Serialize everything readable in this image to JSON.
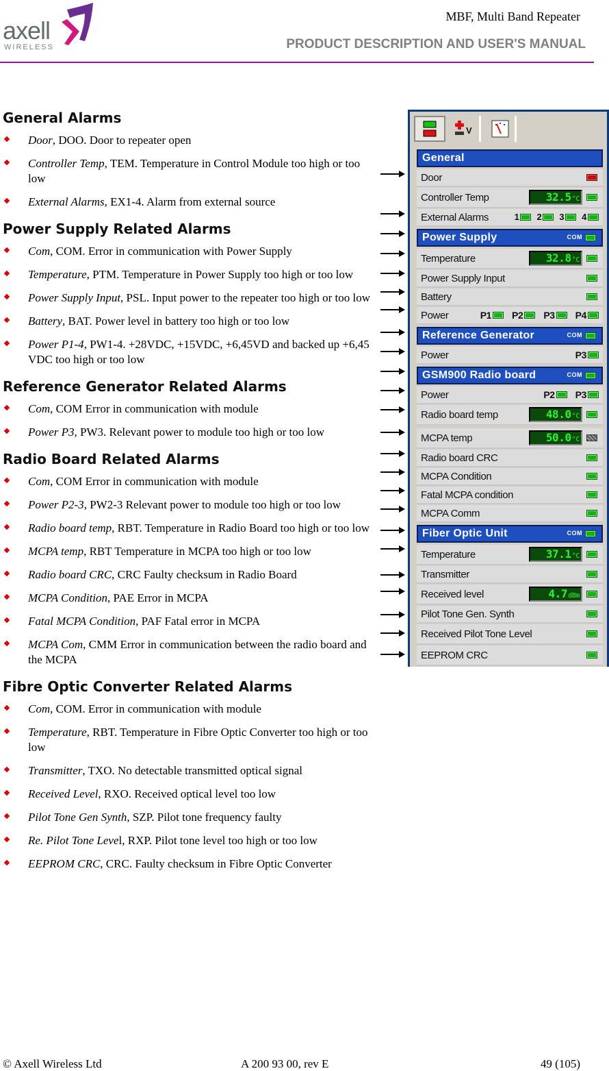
{
  "header": {
    "logo_word": "axell",
    "logo_sub": "WIRELESS",
    "title": "MBF, Multi Band Repeater",
    "subtitle": "PRODUCT DESCRIPTION AND USER'S MANUAL"
  },
  "sections": [
    {
      "heading": "General Alarms",
      "items": [
        {
          "term": "Door",
          "text": ", DOO. Door to repeater open"
        },
        {
          "term": "Controller Temp",
          "text": ", TEM. Temperature in Control Module too high or too low"
        },
        {
          "term": "External Alarms",
          "text": ", EX1-4. Alarm from external source"
        }
      ]
    },
    {
      "heading": "Power Supply Related Alarms",
      "items": [
        {
          "term": "Com",
          "text": ", COM. Error in communication with Power Supply"
        },
        {
          "term": "Temperature",
          "text": ", PTM. Temperature in Power Supply too high or too low"
        },
        {
          "term": "Power Supply Input",
          "text": ", PSL. Input power to the repeater too high or too low"
        },
        {
          "term": "Battery",
          "text": ", BAT. Power level in battery too high or too low"
        },
        {
          "term": "Power P1-4",
          "text": ", PW1-4. +28VDC, +15VDC, +6,45VD and backed up +6,45 VDC too high or too low"
        }
      ]
    },
    {
      "heading": "Reference Generator Related Alarms",
      "items": [
        {
          "term": "Com",
          "text": ", COM  Error in communication with module"
        },
        {
          "term": "Power P3",
          "text": ", PW3. Relevant power to module too high or too low"
        }
      ]
    },
    {
      "heading": "Radio Board Related Alarms",
      "items": [
        {
          "term": "Com",
          "text": ", COM  Error in communication with module"
        },
        {
          "term": "Power P2-3",
          "text": ", PW2-3   Relevant power to module too high or too low"
        },
        {
          "term": "Radio board temp",
          "text": ", RBT. Temperature in Radio Board too high or too low"
        },
        {
          "term": "MCPA temp",
          "text": ", RBT Temperature in MCPA too high or too low"
        },
        {
          "term": "Radio board CRC",
          "text": ", CRC Faulty checksum in Radio Board"
        },
        {
          "term": "MCPA Condition",
          "text": ", PAE Error in MCPA"
        },
        {
          "term": "Fatal MCPA Condition",
          "text": ", PAF Fatal error in MCPA"
        },
        {
          "term": "MCPA Com",
          "text": ", CMM Error in communication between the radio board and the MCPA"
        }
      ]
    },
    {
      "heading": "Fibre Optic Converter Related Alarms",
      "items": [
        {
          "term": "Com",
          "text": ", COM. Error in communication with module"
        },
        {
          "term": "Temperature",
          "text": ", RBT. Temperature in Fibre Optic Converter too high or too low"
        },
        {
          "term": "Transmitter",
          "text": ", TXO. No detectable transmitted optical signal"
        },
        {
          "term": "Received Level",
          "text": ", RXO. Received optical level too low"
        },
        {
          "term": "Pilot Tone Gen Synth",
          "text": ", SZP. Pilot tone frequency faulty"
        },
        {
          "term": "Re. Pilot Tone Leve",
          "text": "l, RXP. Pilot tone level too high or too low"
        },
        {
          "term": "EEPROM CRC",
          "text": ", CRC. Faulty checksum in Fibre Optic Converter"
        }
      ]
    }
  ],
  "panel": {
    "tabs": [
      "alarms-tab",
      "voltages-tab",
      "meter-tab"
    ],
    "com_label": "COM",
    "groups": {
      "general": "General",
      "power_supply": "Power Supply",
      "ref_gen": "Reference Generator",
      "radio": "GSM900 Radio board",
      "fiber": "Fiber Optic Unit"
    },
    "rows": {
      "door": "Door",
      "controller_temp": "Controller Temp",
      "controller_temp_value": "32.5",
      "external_alarms": "External Alarms",
      "ext_ports": [
        "1",
        "2",
        "3",
        "4"
      ],
      "ps_temperature": "Temperature",
      "ps_temperature_value": "32.8",
      "ps_input": "Power Supply Input",
      "battery": "Battery",
      "ps_power": "Power",
      "ps_ports": [
        "P1",
        "P2",
        "P3",
        "P4"
      ],
      "rg_power": "Power",
      "rg_port": "P3",
      "rb_power": "Power",
      "rb_ports": [
        "P2",
        "P3"
      ],
      "rb_temp": "Radio board temp",
      "rb_temp_value": "48.0",
      "mcpa_temp": "MCPA temp",
      "mcpa_temp_value": "50.0",
      "rb_crc": "Radio board CRC",
      "mcpa_condition": "MCPA Condition",
      "fatal_mcpa": "Fatal MCPA condition",
      "mcpa_comm": "MCPA Comm",
      "fo_temperature": "Temperature",
      "fo_temperature_value": "37.1",
      "transmitter": "Transmitter",
      "received_level": "Received level",
      "received_level_value": "4.7",
      "pilot_synth": "Pilot Tone Gen. Synth",
      "pilot_level": "Received Pilot Tone Level",
      "eeprom_crc": "EEPROM CRC"
    },
    "units": {
      "celsius": "°C",
      "dbm": "dBm"
    },
    "status_colors": {
      "ok": "#18b018",
      "alarm": "#c01010",
      "disabled": "#777777"
    }
  },
  "footer": {
    "left": "© Axell Wireless Ltd",
    "center": "A 200 93 00, rev E",
    "right": "49 (105)"
  }
}
